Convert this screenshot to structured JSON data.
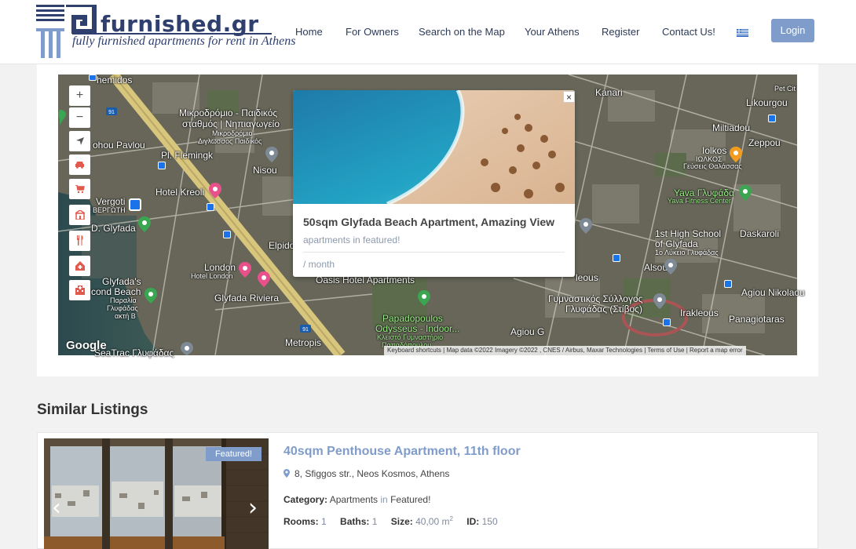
{
  "brand": {
    "name": "furnished.gr",
    "tagline": "fully furnished apartments for rent in Athens"
  },
  "nav": {
    "items": [
      "Home",
      "For Owners",
      "Search on the Map",
      "Your Athens",
      "Register",
      "Contact Us!"
    ],
    "language_flag": "greek-flag-icon",
    "login_label": "Login"
  },
  "map": {
    "labels": {
      "kanari": "Kanari",
      "likourgou": "Likourgou",
      "pet_city": "Pet Cit",
      "themidos": "hemidos",
      "mikrodromio1": "Μικροδρόμιο - Παιδικός",
      "mikrodromio2": "σταθμός | Νηπιαγωγείο",
      "mikrodromio3": "Μικροδρόμιο",
      "mikrodromio4": "Διγλωσσος Παιδικός",
      "pl_fleming": "Pl. Flemingk",
      "nisou": "Nisou",
      "hotel_kreoli": "Hotel Kreoli",
      "vergoti": "Vergoti",
      "vergoti2": "ΒΕΡΓΩΤΗ",
      "d_glyfada": "D. Glyfada",
      "elpidos": "Elpidos",
      "london": "London",
      "hotel_london": "Hotel London",
      "oasis": "Oasis Hotel Apartments",
      "glyfada_beach1": "Glyfada's",
      "glyfada_beach2": "cond Beach",
      "glyfada_beach3": "Παραλία",
      "glyfada_beach4": "Γλυφάδας",
      "glyfada_beach5": "ακτή Β",
      "glyfada_riviera": "Glyfada Riviera",
      "papadopoulos1": "Papadopoulos",
      "papadopoulos2": "Odysseus - Indoor...",
      "papadopoulos3": "Κλειστό Γυμναστήριο",
      "papadopoulos4": "Παπαδόπουλου",
      "seatrac": "SeaTrac Γλυφάδας",
      "metropis": "Metropis",
      "iolkos1": "Iolkos",
      "iolkos2": "ΙΩΛΚΟΣ",
      "iolkos3": "Γεύσεις Θαλάσσας",
      "yava1": "Yava Γλυφάδα",
      "yava2": "Yava Fitness Center",
      "miltiadou": "Miltiadou",
      "zeppou": "Zeppou",
      "school1": "1st High School",
      "school2": "of Glyfada",
      "school3": "1ο Λύκειο Γλυφάδας",
      "daskaroli": "Daskaroli",
      "gym1": "Γυμναστικός Σύλλογος",
      "gym2": "Γλυφάδας (Στίβος)",
      "irakleous": "Irakleous",
      "agiou_nikolaou": "Agiou Nikolaou",
      "panagiotaras": "Panagiotaras",
      "alsous": "Alsous",
      "leous": "leous",
      "agiou_g": "Agiou G",
      "road_91a": "91",
      "road_91b": "91",
      "sokratous": "ohou Pavlou"
    },
    "controls": {
      "zoom_in": "+",
      "zoom_out": "−"
    },
    "popup": {
      "title": "50sqm Glyfada Beach Apartment, Amazing View",
      "category": "apartments in featured!",
      "price": "/ month",
      "close": "×"
    },
    "google": "Google",
    "attribution": "Keyboard shortcuts  |  Map data ©2022 Imagery ©2022 , CNES / Airbus, Maxar Technologies  |  Terms of Use  |  Report a map error"
  },
  "similar": {
    "heading": "Similar Listings",
    "listing": {
      "badge": "Featured!",
      "title": "40sqm Penthouse Apartment, 11th floor",
      "address": "8, Sfiggos str., Neos Kosmos, Athens",
      "category_label": "Category:",
      "category_value": "Apartments",
      "category_in": "in",
      "category_group": "Featured!",
      "rooms_label": "Rooms:",
      "rooms": "1",
      "baths_label": "Baths:",
      "baths": "1",
      "size_label": "Size:",
      "size": "40,00 m",
      "size_sup": "2",
      "id_label": "ID:",
      "id": "150"
    }
  },
  "colors": {
    "brand_navy": "#2f3f6e",
    "accent_blue": "#7f9cca"
  }
}
